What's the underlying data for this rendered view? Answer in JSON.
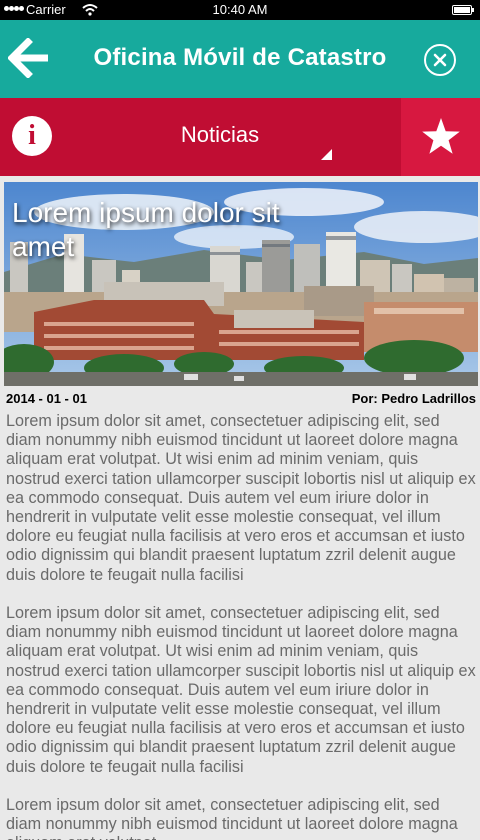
{
  "status_bar": {
    "carrier": "Carrier",
    "time": "10:40 AM"
  },
  "app_bar": {
    "title": "Oficina Móvil de Catastro"
  },
  "tab_bar": {
    "section": "Noticias"
  },
  "article": {
    "headline": "Lorem ipsum dolor sit amet",
    "date": "2014 - 01 - 01",
    "author": "Por: Pedro Ladrillos",
    "paragraphs": [
      "Lorem ipsum dolor sit amet, consectetuer adipiscing elit, sed diam nonummy nibh euismod tincidunt ut laoreet dolore magna aliquam erat volutpat. Ut wisi enim ad minim veniam, quis nostrud exerci tation ullamcorper suscipit lobortis nisl ut aliquip ex ea commodo consequat. Duis autem vel eum iriure dolor in hendrerit in vulputate velit esse molestie consequat, vel illum dolore eu feugiat nulla facilisis at vero eros et accumsan et iusto odio dignissim qui blandit praesent luptatum zzril delenit augue duis dolore te feugait nulla facilisi",
      "Lorem ipsum dolor sit amet, consectetuer adipiscing elit, sed diam nonummy nibh euismod tincidunt ut laoreet dolore magna aliquam erat volutpat. Ut wisi enim ad minim veniam, quis nostrud exerci tation ullamcorper suscipit lobortis nisl ut aliquip ex ea commodo consequat. Duis autem vel eum iriure dolor in hendrerit in vulputate velit esse molestie consequat, vel illum dolore eu feugiat nulla facilisis at vero eros et accumsan et iusto odio dignissim qui blandit praesent luptatum zzril delenit augue duis dolore te feugait nulla facilisi",
      "Lorem ipsum dolor sit amet, consectetuer adipiscing elit, sed diam nonummy nibh euismod tincidunt ut laoreet dolore magna aliquam erat volutpat."
    ]
  },
  "icons": {
    "back": "arrow-left-icon",
    "close": "close-circle-icon",
    "info": "info-icon",
    "favorite": "star-icon",
    "dropdown": "dropdown-caret-icon"
  },
  "colors": {
    "app_bar": "#17aa9d",
    "tab_bar": "#c00d33",
    "favorite_tab": "#d71840",
    "body_text": "#6a6a6a"
  }
}
